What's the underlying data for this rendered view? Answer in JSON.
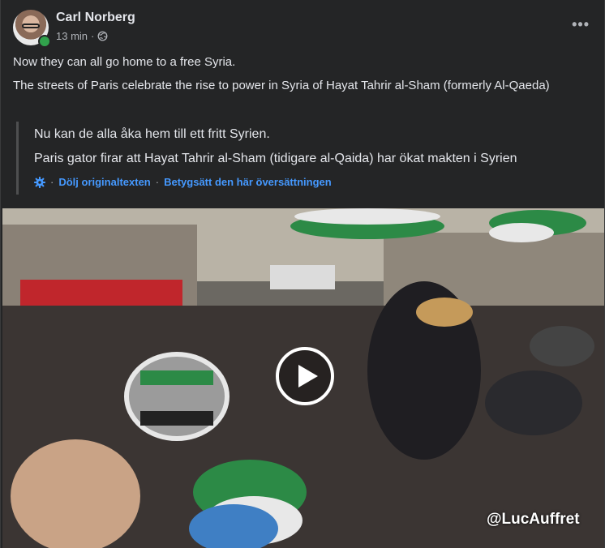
{
  "post": {
    "author": "Carl Norberg",
    "time": "13 min",
    "dot": "·",
    "privacy_icon": "globe-icon",
    "more_icon": "more-options-icon",
    "more_label": "•••",
    "text_lines": [
      "Now they can all go home to a free Syria.",
      "The streets of Paris celebrate the rise to power in Syria of Hayat Tahrir al-Sham (formerly Al-Qaeda)"
    ]
  },
  "original": {
    "lines": [
      "Nu kan de alla åka hem till ett fritt Syrien.",
      "Paris gator firar att Hayat Tahrir al-Sham (tidigare al-Qaida) har ökat makten i Syrien"
    ],
    "settings_icon": "gear-icon",
    "hide_original": "Dölj originaltexten",
    "rate_translation": "Betygsätt den här översättningen",
    "sep": "·"
  },
  "video": {
    "watermark": "@LucAuffret",
    "play_icon": "play-icon"
  },
  "colors": {
    "background": "#242526",
    "text": "#e4e6eb",
    "secondary": "#b0b3b8",
    "link": "#4599ff",
    "online": "#31a24c"
  }
}
